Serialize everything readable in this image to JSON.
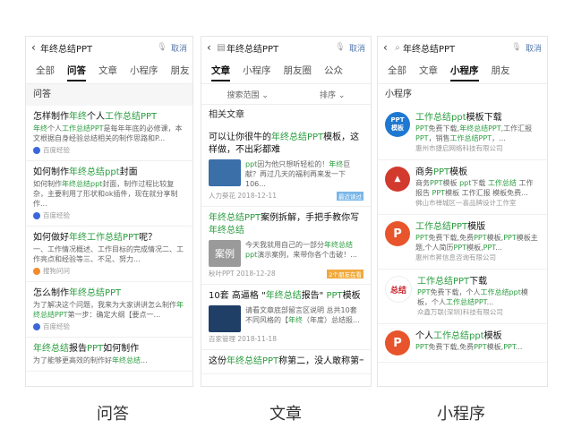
{
  "search": {
    "query": "年终总结PPT",
    "cancel": "取消"
  },
  "panel1": {
    "tabs": [
      "全部",
      "问答",
      "文章",
      "小程序",
      "朋友"
    ],
    "section": "问答",
    "items": [
      {
        "title": "怎样制作年终个人工作总结PPT",
        "desc": "年终个人工作总结PPT是每年年底的必修课，本文根据自身经验总结相关的制作思路和P...",
        "src": "百度经验"
      },
      {
        "title": "如何制作年终总结ppt封面",
        "desc": "如何制作年终总结ppt封面，制作过程比较复杂，主要利用了形状和ok插件，现在就分享制作...",
        "src": "百度经验"
      },
      {
        "title": "如何做好年终工作总结PPT呢？",
        "desc": "一、工作情况概述、工作目标的完成情况二、工作亮点和经验等三、不足、努力...",
        "src": "搜狗问问"
      },
      {
        "title": "怎么制作年终总结PPT",
        "desc": "为了解决这个问题，我来为大家讲讲怎么制作年终总结PPT第一步：确定大纲【要点一...",
        "src": "百度经验"
      },
      {
        "title": "年终总结报告PPT如何制作",
        "desc": "为了能够更高效的制作好年终总结...",
        "src": ""
      }
    ]
  },
  "panel2": {
    "tabs": [
      "文章",
      "小程序",
      "朋友圈",
      "公众"
    ],
    "filter": [
      "搜索范围",
      "排序"
    ],
    "section": "相关文章",
    "items": [
      {
        "title": "可以让你很牛的年终总结PPT模板，这样做，不出彩都难",
        "desc": "ppt因为他只想听轻松的！年终巨献？再过几天的福利再来发一下106...",
        "src": "人力葵花  2018-12-11",
        "tag": "最近读过",
        "thumb": "#3a6fa8"
      },
      {
        "title": "年终总结PPT案例拆解，手把手教你写年终总结",
        "desc": "今天我就用自己的一部分年终总结ppt演示案例，来带你各个击破！...",
        "src": "秋叶PPT  2018-12-28",
        "tag": "2个朋友在看",
        "thumb": "#9a9a9a",
        "thumbText": "案例"
      },
      {
        "title": "10套 高逼格 \"年终总结报告\" PPT模板",
        "desc": "请看文章底部留言区说明 总共10套不同风格的【年终（年度）总结报...",
        "src": "百家管理  2018-11-18",
        "tag": "",
        "thumb": "#1f3f66"
      },
      {
        "title": "这份年终总结PPT称第二，没人敢称第一",
        "desc": "",
        "src": "",
        "tag": ""
      }
    ]
  },
  "panel3": {
    "tabs": [
      "全部",
      "文章",
      "小程序",
      "朋友"
    ],
    "section": "小程序",
    "items": [
      {
        "title": "工作总结ppt模板下载",
        "desc": "PPT免费下载,年终总结PPT,工作汇报PPT，销售工作总结PPT，...",
        "co": "惠州市捷启网络科技有限公司",
        "icon": "PPT\n模板",
        "color": "#1f78d1"
      },
      {
        "title": "商务PPT模板",
        "desc": "商务PPT模板 ppt下载 工作总结 工作报告 PPT模板 工作汇报 模板免费...",
        "co": "佛山市禅城区一喜品牌设计工作室",
        "icon": "",
        "color": "#d23a2e"
      },
      {
        "title": "工作总结PPT模版",
        "desc": "PPT免费下载,免费PPT模板,PPT模板主题,个人简历PPT模板,PPT...",
        "co": "惠州市昇信息咨询有限公司",
        "icon": "P",
        "color": "#e8542b"
      },
      {
        "title": "工作总结PPT下载",
        "desc": "PPT免费下载，个人工作总结ppt模板，个人工作总结PPT...",
        "co": "众鑫万联(深圳)科技有限公司",
        "icon": "总结",
        "color": "#c9272d"
      },
      {
        "title": "个人工作总结ppt模板",
        "desc": "PPT免费下载,免费PPT模板,PPT...",
        "co": "",
        "icon": "P",
        "color": "#e8542b"
      }
    ]
  },
  "captions": [
    "问答",
    "文章",
    "小程序"
  ]
}
